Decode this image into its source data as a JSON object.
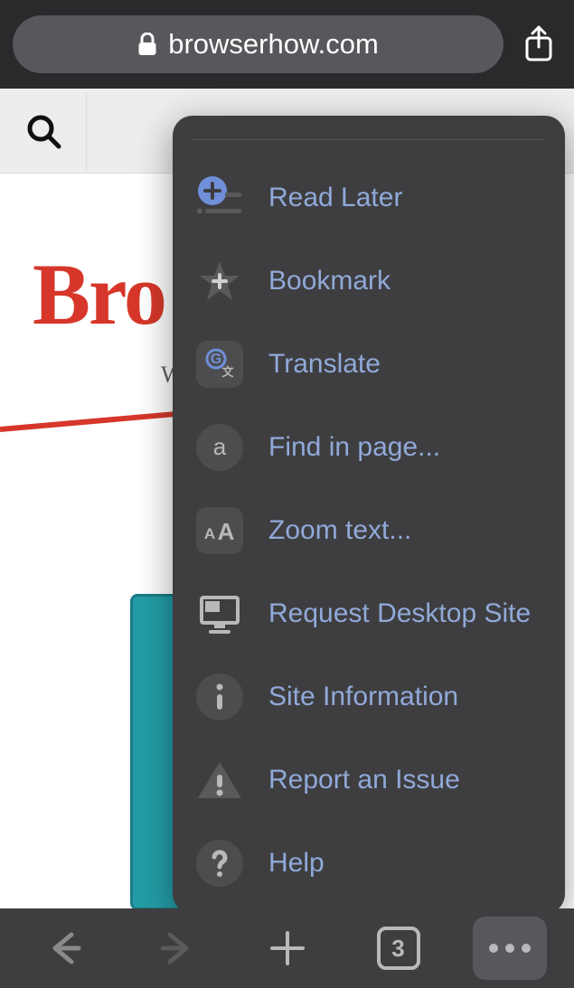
{
  "chrome": {
    "url": "browserhow.com"
  },
  "page": {
    "logo_fragment": "Bro",
    "tagline_fragment": "W"
  },
  "menu": {
    "items": [
      {
        "label": "Read Later",
        "icon": "read-later-icon"
      },
      {
        "label": "Bookmark",
        "icon": "bookmark-star-icon"
      },
      {
        "label": "Translate",
        "icon": "translate-icon"
      },
      {
        "label": "Find in page...",
        "icon": "find-in-page-icon"
      },
      {
        "label": "Zoom text...",
        "icon": "zoom-text-icon"
      },
      {
        "label": "Request Desktop Site",
        "icon": "desktop-icon"
      },
      {
        "label": "Site Information",
        "icon": "info-icon"
      },
      {
        "label": "Report an Issue",
        "icon": "warning-icon"
      },
      {
        "label": "Help",
        "icon": "help-icon"
      }
    ]
  },
  "bottom_bar": {
    "tab_count": "3"
  }
}
